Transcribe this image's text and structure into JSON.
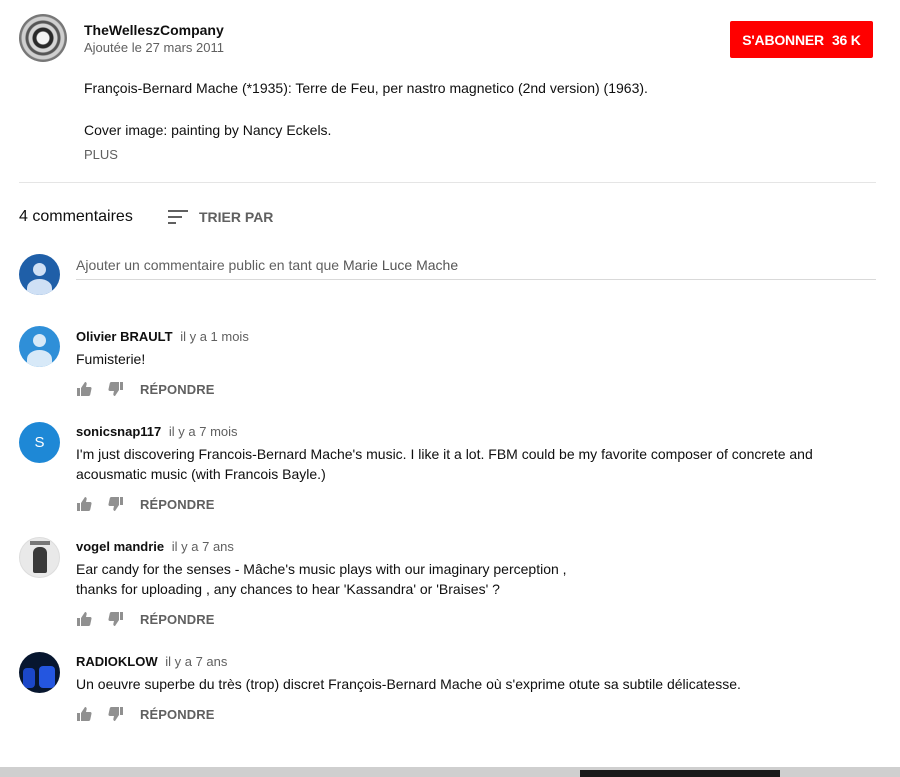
{
  "channel": {
    "name": "TheWelleszCompany",
    "date": "Ajoutée le 27 mars 2011",
    "subscribe_label": "S'ABONNER",
    "subscriber_count": "36 K"
  },
  "description": {
    "line1": "François-Bernard Mache (*1935): Terre de Feu, per nastro magnetico (2nd version) (1963).",
    "line2": "Cover image: painting by Nancy Eckels.",
    "more_label": "PLUS"
  },
  "comments_header": {
    "count_label": "4 commentaires",
    "sort_label": "TRIER PAR"
  },
  "new_comment": {
    "prompt": "Ajouter un commentaire public en tant que",
    "user": "Marie Luce Mache"
  },
  "comments": [
    {
      "author": "Olivier BRAULT",
      "time": "il y a 1 mois",
      "text": [
        "Fumisterie!"
      ],
      "reply_label": "RÉPONDRE"
    },
    {
      "author": "sonicsnap117",
      "time": "il y a 7 mois",
      "avatar_letter": "S",
      "text": [
        "I'm just discovering Francois-Bernard Mache's music. I like it a lot. FBM could be my favorite composer of concrete and",
        "acousmatic music (with Francois Bayle.)"
      ],
      "reply_label": "RÉPONDRE"
    },
    {
      "author": "vogel mandrie",
      "time": "il y a 7 ans",
      "text": [
        "Ear candy for the senses - Mâche's music plays with our imaginary perception ,",
        "thanks for uploading , any chances to hear 'Kassandra' or 'Braises' ?"
      ],
      "reply_label": "RÉPONDRE"
    },
    {
      "author": "RADIOKLOW",
      "time": "il y a 7 ans",
      "text": [
        "Un oeuvre superbe du très (trop) discret François-Bernard Mache où s'exprime otute sa subtile délicatesse."
      ],
      "reply_label": "RÉPONDRE"
    }
  ],
  "colors": {
    "subscribe": "#ff0000",
    "secondary_text": "#606060",
    "primary_text": "#0f0f0f"
  }
}
